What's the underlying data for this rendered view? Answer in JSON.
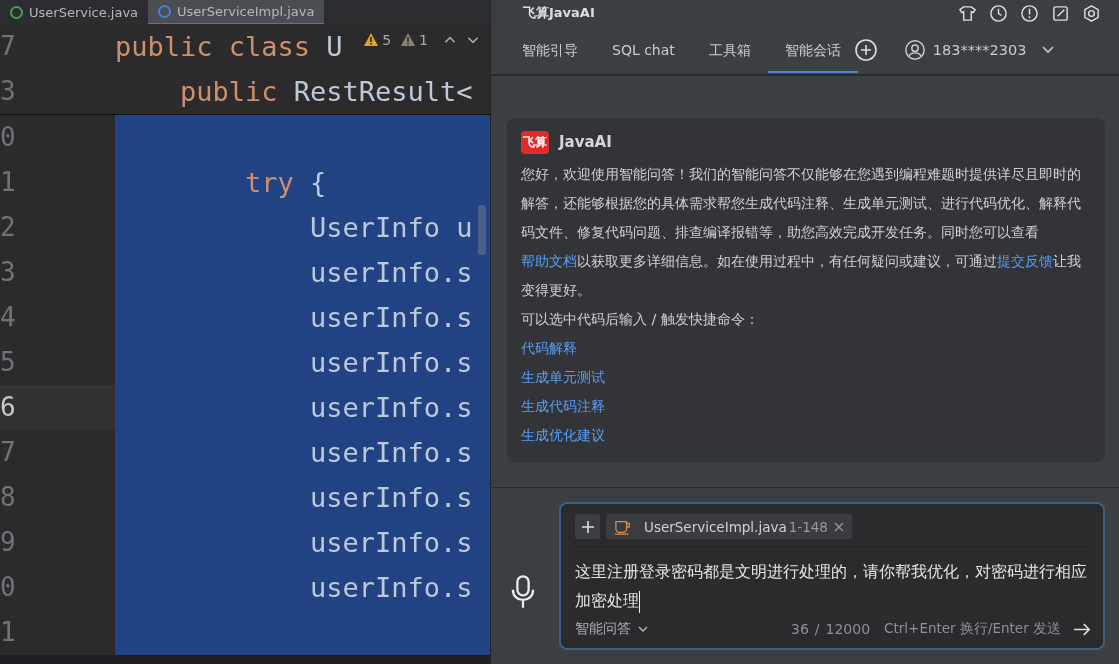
{
  "editor": {
    "tabs": [
      {
        "label": "UserService.java",
        "selected": false,
        "color": "#4e9a4e"
      },
      {
        "label": "UserServiceImpl.java",
        "selected": true,
        "color": "#4a7fd6"
      }
    ],
    "inspections": {
      "warnings": "5",
      "weak_warnings": "1"
    },
    "sticky_lines": [
      {
        "number": "7",
        "code": [
          {
            "text": "public class ",
            "kind": "keyword"
          },
          {
            "text": "U",
            "kind": "plain"
          }
        ]
      },
      {
        "number": "3",
        "code": [
          {
            "text": "    public ",
            "kind": "keyword"
          },
          {
            "text": "RestResult<",
            "kind": "plain"
          }
        ]
      }
    ],
    "lines": [
      {
        "number": "0",
        "current": false
      },
      {
        "number": "1",
        "current": false,
        "code": [
          {
            "text": "        try",
            "kind": "keyword"
          },
          {
            "text": " {",
            "kind": "plain"
          }
        ]
      },
      {
        "number": "2",
        "current": false,
        "code": [
          {
            "text": "            UserInfo u",
            "kind": "plain"
          }
        ]
      },
      {
        "number": "3",
        "current": false,
        "code": [
          {
            "text": "            userInfo.s",
            "kind": "plain"
          }
        ]
      },
      {
        "number": "4",
        "current": false,
        "code": [
          {
            "text": "            userInfo.s",
            "kind": "plain"
          }
        ]
      },
      {
        "number": "5",
        "current": false,
        "code": [
          {
            "text": "            userInfo.s",
            "kind": "plain"
          }
        ]
      },
      {
        "number": "6",
        "current": true,
        "code": [
          {
            "text": "            userInfo.s",
            "kind": "plain"
          }
        ]
      },
      {
        "number": "7",
        "current": false,
        "code": [
          {
            "text": "            userInfo.s",
            "kind": "plain"
          }
        ]
      },
      {
        "number": "8",
        "current": false,
        "code": [
          {
            "text": "            userInfo.s",
            "kind": "plain"
          }
        ]
      },
      {
        "number": "9",
        "current": false,
        "code": [
          {
            "text": "            userInfo.s",
            "kind": "plain"
          }
        ]
      },
      {
        "number": "0",
        "current": false,
        "code": [
          {
            "text": "            userInfo.s",
            "kind": "plain"
          }
        ]
      },
      {
        "number": "1",
        "current": false
      }
    ]
  },
  "assistant": {
    "title": "飞算JavaAI",
    "tabs": [
      {
        "label": "智能引导",
        "selected": false
      },
      {
        "label": "SQL chat",
        "selected": false
      },
      {
        "label": "工具箱",
        "selected": false
      },
      {
        "label": "智能会话",
        "selected": true
      }
    ],
    "account": "183****2303",
    "welcome": {
      "logo": "飞算",
      "name": "JavaAI",
      "paragraph": [
        {
          "text": "您好，欢迎使用智能问答！我们的智能问答不仅能够在您遇到编程难题时提供详尽且即时的解答，还能够根据您的具体需求帮您生成代码注释、生成单元测试、进行代码优化、解释代码文件、修复代码问题、排查编译报错等，助您高效完成开发任务。同时您可以查看",
          "link": false
        },
        {
          "text": "帮助文档",
          "link": true
        },
        {
          "text": "以获取更多详细信息。如在使用过程中，有任何疑问或建议，可通过",
          "link": false
        },
        {
          "text": "提交反馈",
          "link": true
        },
        {
          "text": "让我变得更好。",
          "link": false
        }
      ],
      "hint": "可以选中代码后输入 / 触发快捷命令：",
      "commands": [
        "代码解释",
        "生成单元测试",
        "生成代码注释",
        "生成优化建议"
      ]
    },
    "input": {
      "file": "UserServiceImpl.java",
      "range": "1-148",
      "value": "这里注册登录密码都是文明进行处理的，请你帮我优化，对密码进行相应加密处理",
      "mode": "智能问答",
      "count": "36",
      "separator": "/",
      "limit": "12000",
      "shortcut": "Ctrl+Enter 换行/Enter 发送"
    }
  }
}
